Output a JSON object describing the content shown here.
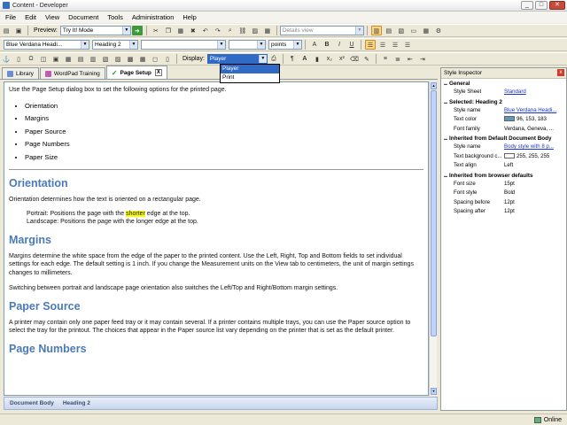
{
  "window": {
    "title": "Content - Developer"
  },
  "menu": [
    "File",
    "Edit",
    "View",
    "Document",
    "Tools",
    "Administration",
    "Help"
  ],
  "toolbar1": {
    "preview_label": "Preview:",
    "preview_mode": "Try It! Mode",
    "view_combo": "Details view"
  },
  "toolbar2": {
    "style_combo": "Blue Verdana Headi...",
    "heading_combo": "Heading 2",
    "units_combo": "points"
  },
  "toolbar3": {
    "display_label": "Display:",
    "display_value": "Player"
  },
  "display_dropdown": {
    "options": [
      "Player",
      "Print"
    ],
    "selected": "Player"
  },
  "tabs": [
    {
      "label": "Library"
    },
    {
      "label": "WordPad Training"
    },
    {
      "label": "Page Setup",
      "close": "X"
    }
  ],
  "doc": {
    "intro": "Use the Page Setup dialog box to set the following options for the printed page.",
    "bullets": [
      "Orientation",
      "Margins",
      "Paper Source",
      "Page Numbers",
      "Paper Size"
    ],
    "h_orientation": "Orientation",
    "p_orientation": "Orientation determines how the text is oriented on a rectangular page.",
    "portrait_pre": "Portrait: Positions the page with the ",
    "portrait_hl": "shorter",
    "portrait_post": " edge at the top.",
    "landscape": "Landscape: Positions the page with the longer edge at the top.",
    "h_margins": "Margins",
    "p_margins1": "Margins determine the white space from the edge of the paper to the printed content. Use the Left, Right, Top and Bottom fields to set individual settings for each edge. The default setting is 1 inch. If you change the Measurement units on the View tab to centimeters, the unit of margin settings changes to millimeters.",
    "p_margins2": "Switching between portrait and landscape page orientation also switches the Left/Top and Right/Bottom margin settings.",
    "h_paper": "Paper Source",
    "p_paper": "A printer may contain only one paper feed tray or it may contain several. If a printer contains multiple trays, you can use the Paper source option to select the tray for the printout. The choices that appear in the Paper source list vary depending on the printer that is set as the default printer.",
    "h_pagenum": "Page Numbers"
  },
  "doc_status": [
    "Document Body",
    "Heading 2"
  ],
  "inspector": {
    "title": "Style Inspector",
    "close": "x",
    "general": "General",
    "style_sheet_k": "Style Sheet",
    "style_sheet_v": "Standard",
    "selected": "Selected: Heading 2",
    "style_name_k": "Style name",
    "style_name_v": "Blue Verdana Headi...",
    "text_color_k": "Text color",
    "text_color_v": "96, 153, 183",
    "font_family_k": "Font family",
    "font_family_v": "Verdana, Geneva, ...",
    "inh_doc": "Inherited from Default Document Body",
    "style_name2_v": "Body style with 8 p...",
    "text_bg_k": "Text background c...",
    "text_bg_v": "255, 255, 255",
    "text_align_k": "Text align",
    "text_align_v": "Left",
    "inh_browser": "Inherited from browser defaults",
    "font_size_k": "Font size",
    "font_size_v": "15pt",
    "font_style_k": "Font style",
    "font_style_v": "Bold",
    "sp_before_k": "Spacing before",
    "sp_before_v": "12pt",
    "sp_after_k": "Spacing after",
    "sp_after_v": "12pt"
  },
  "status": {
    "online": "Online"
  },
  "colors": {
    "heading": "#4a7ab8",
    "text_color_swatch": "#6099b7",
    "highlight": "#ffff00"
  }
}
